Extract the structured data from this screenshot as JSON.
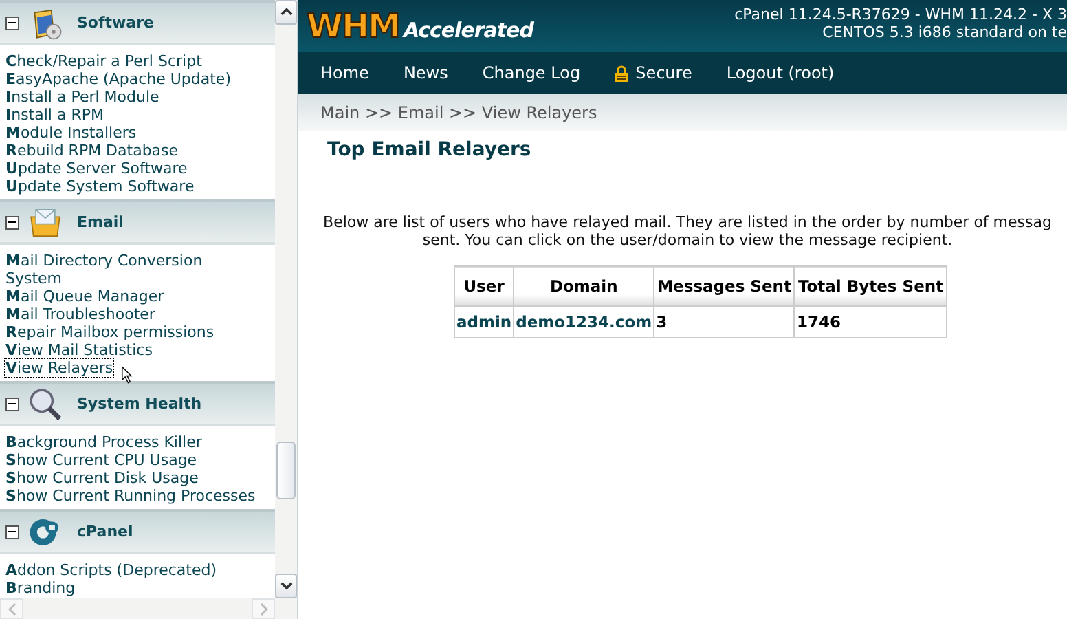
{
  "sidebar": {
    "sections": [
      {
        "title": "Software",
        "kind": "software",
        "expanded": true,
        "items": [
          {
            "label": "**C**heck/Repair a Perl Script",
            "selected": false
          },
          {
            "label": "**E**asyApache (Apache Update)",
            "selected": false
          },
          {
            "label": "**I**nstall a Perl Module",
            "selected": false
          },
          {
            "label": "**I**nstall a RPM",
            "selected": false
          },
          {
            "label": "**M**odule Installers",
            "selected": false
          },
          {
            "label": "**R**ebuild RPM Database",
            "selected": false
          },
          {
            "label": "**U**pdate Server Software",
            "selected": false
          },
          {
            "label": "**U**pdate System Software",
            "selected": false
          }
        ]
      },
      {
        "title": "Email",
        "kind": "email",
        "expanded": true,
        "items": [
          {
            "label": "**M**ail Directory Conversion System",
            "selected": false
          },
          {
            "label": "**M**ail Queue Manager",
            "selected": false
          },
          {
            "label": "**M**ail Troubleshooter",
            "selected": false
          },
          {
            "label": "**R**epair Mailbox permissions",
            "selected": false
          },
          {
            "label": "**V**iew Mail Statistics",
            "selected": false
          },
          {
            "label": "**V**iew Relayers",
            "selected": true
          }
        ]
      },
      {
        "title": "System Health",
        "kind": "health",
        "expanded": true,
        "items": [
          {
            "label": "**B**ackground Process Killer",
            "selected": false
          },
          {
            "label": "**S**how Current CPU Usage",
            "selected": false
          },
          {
            "label": "**S**how Current Disk Usage",
            "selected": false
          },
          {
            "label": "**S**how Current Running Processes",
            "selected": false
          }
        ]
      },
      {
        "title": "cPanel",
        "kind": "cpanel",
        "expanded": true,
        "items": [
          {
            "label": "**A**ddon Scripts (Deprecated)",
            "selected": false
          },
          {
            "label": "**B**randing",
            "selected": false
          }
        ]
      }
    ]
  },
  "header": {
    "logo_main": "WHM",
    "logo_sub": "Accelerated",
    "version_lines": [
      "cPanel 11.24.5-R37629 - WHM 11.24.2 - X 3",
      "CENTOS 5.3 i686 standard on te"
    ]
  },
  "nav": [
    {
      "label": "Home",
      "kind": "link"
    },
    {
      "label": "News",
      "kind": "link"
    },
    {
      "label": "Change Log",
      "kind": "link"
    },
    {
      "label": "Secure",
      "kind": "lock"
    },
    {
      "label": "Logout (root)",
      "kind": "link"
    }
  ],
  "breadcrumb": "Main >> Email >> View Relayers",
  "page_title": "Top Email Relayers",
  "intro_lines": [
    "Below are list of users who have relayed mail. They are listed in the order by number of messag",
    "sent. You can click on the user/domain to view the message recipient."
  ],
  "table": {
    "columns": [
      "User",
      "Domain",
      "Messages Sent",
      "Total Bytes Sent"
    ],
    "rows": [
      [
        {
          "text": "admin",
          "kind": "link"
        },
        {
          "text": "demo1234.com",
          "kind": "link"
        },
        {
          "text": "3",
          "kind": "text"
        },
        {
          "text": "1746",
          "kind": "text"
        }
      ]
    ]
  }
}
